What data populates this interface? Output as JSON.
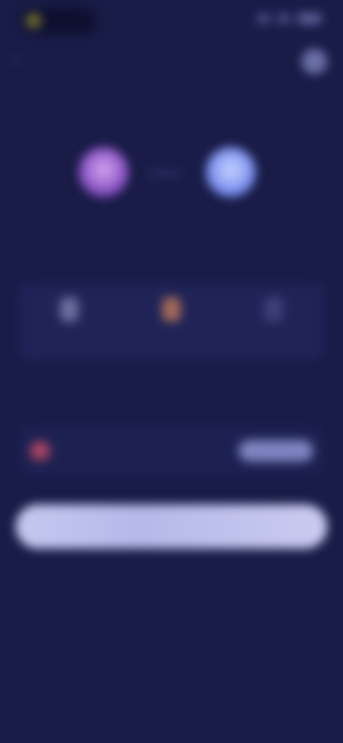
{
  "status": {
    "brand_label": "",
    "icons": [
      "signal-icon",
      "wifi-icon",
      "battery-icon"
    ]
  },
  "header": {
    "back_icon": "chevron-left-icon",
    "settings_icon": "settings-icon",
    "title": ""
  },
  "pair": {
    "from_label": "",
    "to_label": ""
  },
  "sections": {
    "options_label": "",
    "balance_label": ""
  },
  "options": [
    {
      "label": "",
      "icon": "option-icon",
      "color": "#6b6f9f"
    },
    {
      "label": "",
      "icon": "option-icon",
      "color": "#a36a57"
    },
    {
      "label": "",
      "icon": "option-icon",
      "color": "#3d4178"
    }
  ],
  "balance": {
    "amount": "",
    "sub": "",
    "action": ""
  },
  "primary_action": "",
  "colors": {
    "background": "#191c47",
    "card": "#1f2357",
    "accent": "#c5c8f0"
  }
}
